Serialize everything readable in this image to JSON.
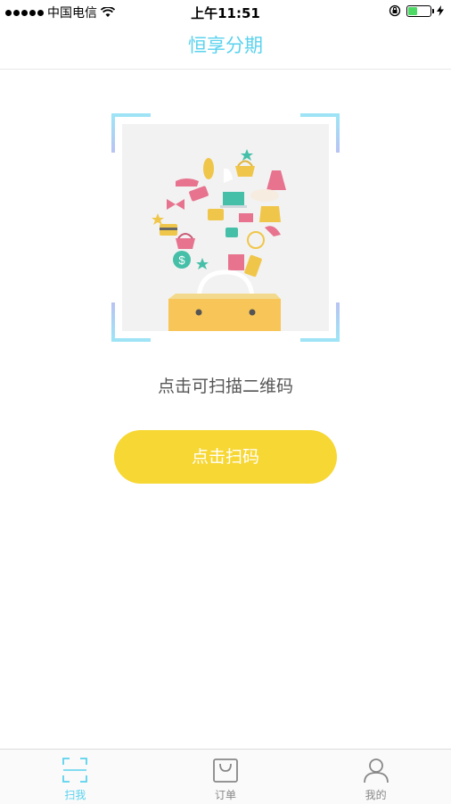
{
  "status_bar": {
    "carrier": "中国电信",
    "time": "上午11:51",
    "battery_level": 0.45
  },
  "header": {
    "title": "恒享分期"
  },
  "main": {
    "hint": "点击可扫描二维码",
    "scan_button_label": "点击扫码"
  },
  "tabbar": {
    "tabs": [
      {
        "label": "扫我",
        "icon": "scan-icon",
        "active": true
      },
      {
        "label": "订单",
        "icon": "shopping-bag-icon",
        "active": false
      },
      {
        "label": "我的",
        "icon": "user-icon",
        "active": false
      }
    ]
  },
  "colors": {
    "accent": "#5ad2ee",
    "button": "#f7d733"
  }
}
